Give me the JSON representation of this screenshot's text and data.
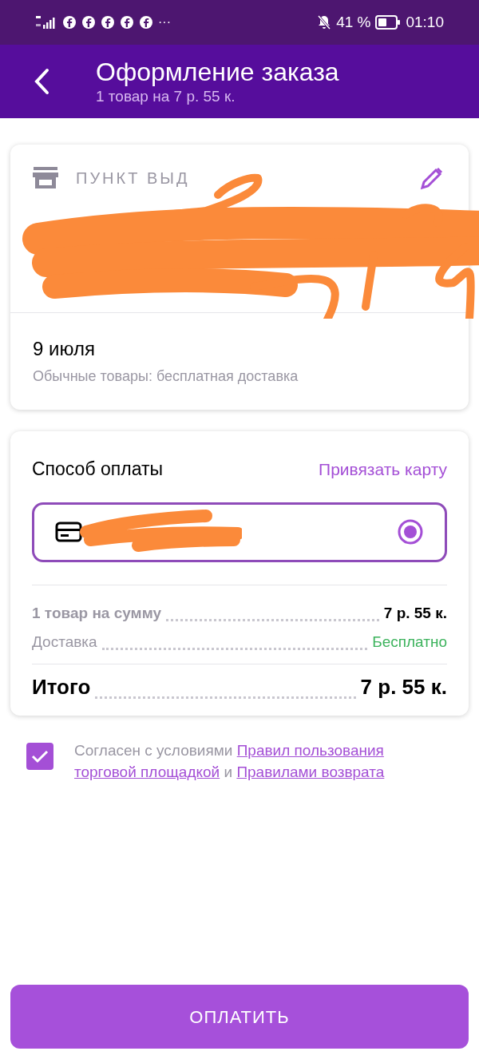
{
  "status_bar": {
    "notification_icons": [
      {
        "kind": "app"
      },
      {
        "kind": "app"
      },
      {
        "kind": "app"
      },
      {
        "kind": "app"
      },
      {
        "kind": "app"
      }
    ],
    "more": "···",
    "battery_percent": "41 %",
    "time": "01:10"
  },
  "header": {
    "title": "Оформление заказа",
    "subtitle": "1 товар на 7 р. 55 к."
  },
  "pickup": {
    "label": "ПУНКТ ВЫД",
    "date": "9 июля",
    "note": "Обычные товары: бесплатная доставка"
  },
  "payment": {
    "title": "Способ оплаты",
    "link": "Привязать карту",
    "card": {
      "selected": true
    }
  },
  "summary": [
    {
      "kind": "items",
      "label": "1 товар на сумму",
      "value": "7 р. 55 к."
    },
    {
      "kind": "delivery",
      "label": "Доставка",
      "value": "Бесплатно"
    },
    {
      "kind": "total",
      "label": "Итого",
      "value": "7 р. 55 к."
    }
  ],
  "agreement": {
    "checked": true,
    "parts": [
      {
        "kind": "text",
        "text": "Согласен с условиями"
      },
      {
        "kind": "link",
        "text": "Правил пользования"
      },
      {
        "kind": "link",
        "text": "торговой площадкой"
      },
      {
        "kind": "text",
        "text": "и"
      },
      {
        "kind": "link",
        "text": "Правилами возврата"
      }
    ]
  },
  "pay_button": "ОПЛАТИТЬ"
}
